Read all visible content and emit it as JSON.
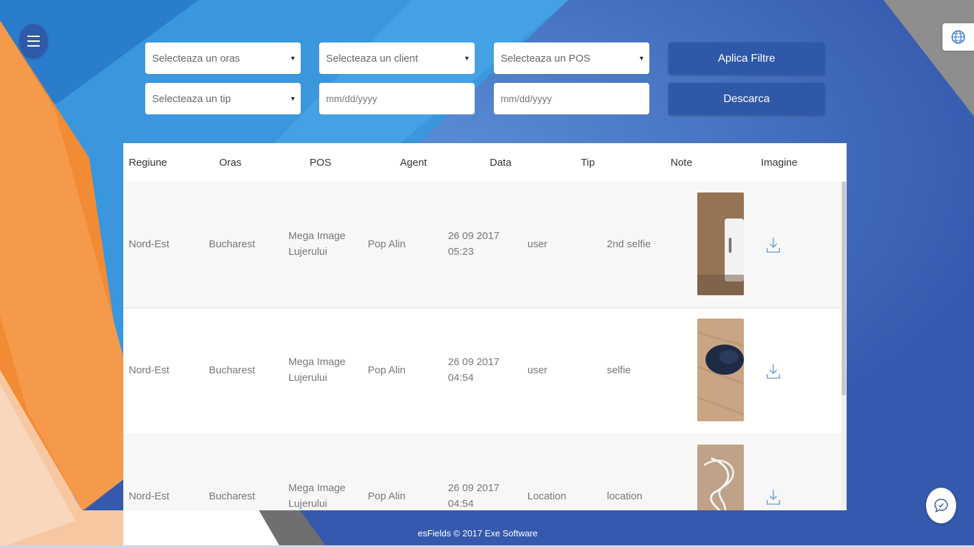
{
  "filters": {
    "city_select": "Selecteaza un oras",
    "client_select": "Selecteaza un client",
    "pos_select": "Selecteaza un POS",
    "type_select": "Selecteaza un tip",
    "date_from_placeholder": "mm/dd/yyyy",
    "date_to_placeholder": "mm/dd/yyyy",
    "apply_label": "Aplica Filtre",
    "download_label": "Descarca"
  },
  "table": {
    "headers": [
      "Regiune",
      "Oras",
      "POS",
      "Agent",
      "Data",
      "Tip",
      "Note",
      "Imagine"
    ],
    "rows": [
      {
        "regiune": "Nord-Est",
        "oras": "Bucharest",
        "pos_line1": "Mega Image",
        "pos_line2": "Lujerului",
        "agent": "Pop Alin",
        "date_line1": "26 09 2017",
        "date_line2": "05:23",
        "tip": "user",
        "note": "2nd selfie"
      },
      {
        "regiune": "Nord-Est",
        "oras": "Bucharest",
        "pos_line1": "Mega Image",
        "pos_line2": "Lujerului",
        "agent": "Pop Alin",
        "date_line1": "26 09 2017",
        "date_line2": "04:54",
        "tip": "user",
        "note": "selfie"
      },
      {
        "regiune": "Nord-Est",
        "oras": "Bucharest",
        "pos_line1": "Mega Image",
        "pos_line2": "Lujerului",
        "agent": "Pop Alin",
        "date_line1": "26 09 2017",
        "date_line2": "04:54",
        "tip": "Location",
        "note": "location"
      }
    ]
  },
  "footer": {
    "text": "esFields © 2017 Exe Software"
  },
  "icons": {
    "menu": "hamburger-icon",
    "globe": "globe-icon",
    "download": "download-icon",
    "chat": "chat-icon"
  },
  "colors": {
    "accent": "#2f58a8",
    "orange": "#f08a3a",
    "background_blue": "#3b62b8"
  }
}
